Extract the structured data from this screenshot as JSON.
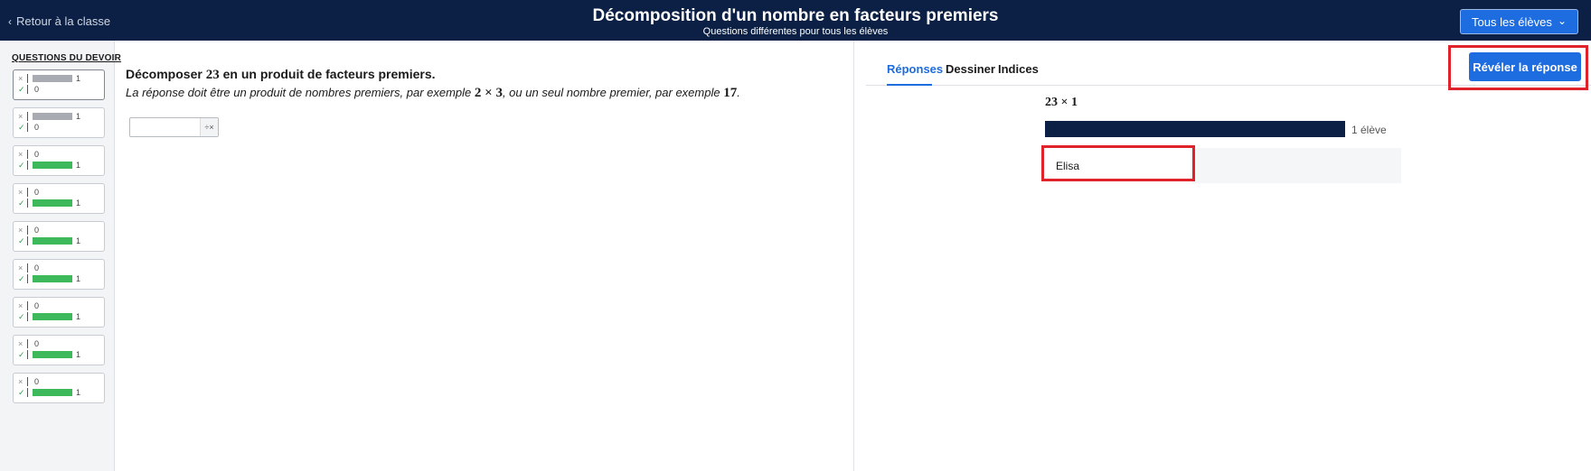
{
  "header": {
    "back_label": "Retour à la classe",
    "title": "Décomposition d'un nombre en facteurs premiers",
    "subtitle": "Questions différentes pour tous les élèves",
    "student_select": "Tous les élèves"
  },
  "sidebar": {
    "title": "QUESTIONS DU DEVOIR",
    "questions": [
      {
        "incorrect": 1,
        "correct": 0,
        "active": true
      },
      {
        "incorrect": 1,
        "correct": 0,
        "active": false
      },
      {
        "incorrect": 0,
        "correct": 1,
        "active": false
      },
      {
        "incorrect": 0,
        "correct": 1,
        "active": false
      },
      {
        "incorrect": 0,
        "correct": 1,
        "active": false
      },
      {
        "incorrect": 0,
        "correct": 1,
        "active": false
      },
      {
        "incorrect": 0,
        "correct": 1,
        "active": false
      },
      {
        "incorrect": 0,
        "correct": 1,
        "active": false
      },
      {
        "incorrect": 0,
        "correct": 1,
        "active": false
      }
    ]
  },
  "question": {
    "prompt_before": "Décomposer ",
    "prompt_number": "23",
    "prompt_after": " en un produit de facteurs premiers.",
    "hint_part1": "La réponse doit être un produit de nombres premiers, par exemple ",
    "hint_example1": "2 × 3",
    "hint_part2": ", ou un seul nombre premier, par exemple ",
    "hint_example2": "17",
    "hint_part3": ".",
    "answer_value": "",
    "keypad_label": "÷×"
  },
  "tabs": [
    {
      "label": "Réponses",
      "active": true
    },
    {
      "label": "Dessiner",
      "active": false
    },
    {
      "label": "Indices",
      "active": false
    }
  ],
  "reveal_button": "Révéler la réponse",
  "responses": {
    "expression": "23 × 1",
    "count_label": "1 élève",
    "share": 1.0,
    "students": [
      "Elisa"
    ]
  },
  "colors": {
    "navy": "#0b2044",
    "blue": "#1d6ce0",
    "green": "#3db85a",
    "highlight_red": "#e0232b"
  }
}
